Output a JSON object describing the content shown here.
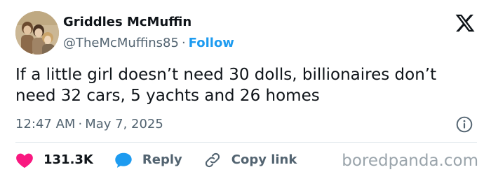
{
  "author": {
    "display_name": "Griddles McMuffin",
    "handle": "@TheMcMuffins85",
    "separator": "·",
    "follow_label": "Follow"
  },
  "tweet": {
    "text": "If a little girl doesn’t need 30 dolls, billionaires don’t need 32 cars, 5 yachts and 26 homes",
    "time": "12:47 AM",
    "separator": "·",
    "date": "May 7, 2025"
  },
  "actions": {
    "like_count": "131.3K",
    "reply_label": "Reply",
    "copy_label": "Copy link"
  },
  "watermark": "boredpanda.com",
  "colors": {
    "accent": "#1d9bf0",
    "like": "#f91880",
    "secondary_text": "#536471"
  },
  "icons": {
    "brand": "x-logo-icon",
    "info": "info-icon",
    "like": "heart-icon",
    "reply": "speech-bubble-icon",
    "copy": "link-icon"
  }
}
